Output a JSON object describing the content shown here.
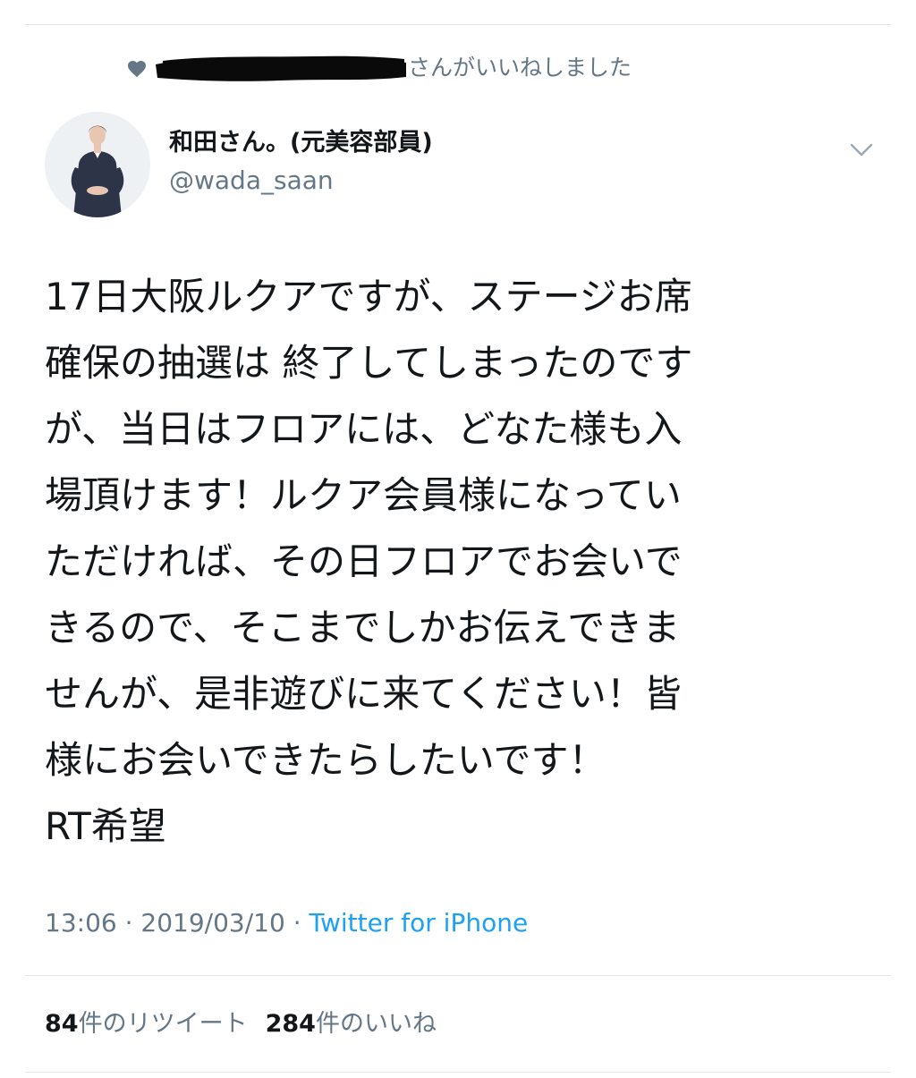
{
  "social_context": {
    "icon": "heart-icon",
    "text": "さんがいいねしました"
  },
  "user": {
    "display_name": "和田さん。(元美容部員)",
    "handle": "@wada_saan"
  },
  "tweet": {
    "lines": [
      "17日大阪ルクアですが、ステージお席",
      "確保の抽選は 終了してしまったのです",
      "が、当日はフロアには、どなた様も入",
      "場頂けます！ルクア会員様になってい",
      "ただければ、その日フロアでお会いで",
      "きるので、そこまでしかお伝えできま",
      "せんが、是非遊びに来てください！皆",
      "様にお会いできたらしたいです！",
      "RT希望"
    ]
  },
  "meta": {
    "time": "13:06",
    "date": "2019/03/10",
    "separator": "·",
    "source": "Twitter for iPhone"
  },
  "stats": {
    "retweet_count": "84",
    "retweet_label": "件のリツイート",
    "like_count": "284",
    "like_label": "件のいいね"
  },
  "colors": {
    "text": "#14171a",
    "secondary": "#657786",
    "link": "#1da1f2",
    "divider": "#e1e8ed"
  }
}
